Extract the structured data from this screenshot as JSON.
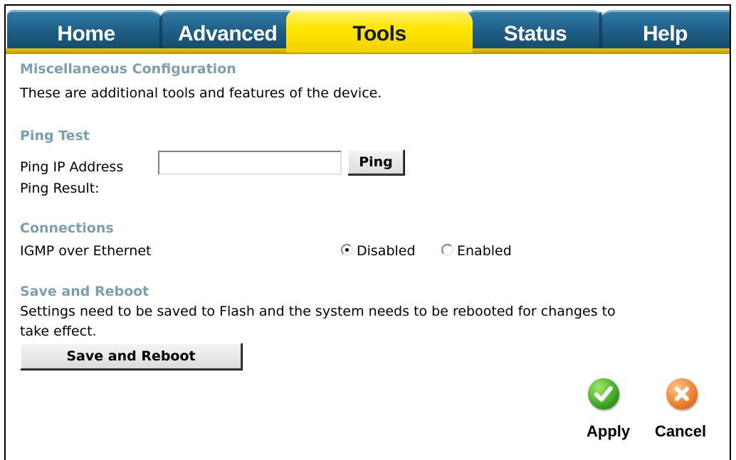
{
  "tabs": [
    {
      "label": "Home"
    },
    {
      "label": "Advanced"
    },
    {
      "label": "Tools"
    },
    {
      "label": "Status"
    },
    {
      "label": "Help"
    }
  ],
  "misc": {
    "title": "Miscellaneous Configuration",
    "description": "These are additional tools and features of the device."
  },
  "ping": {
    "title": "Ping Test",
    "ip_label": "Ping IP Address",
    "ip_value": "",
    "button": "Ping",
    "result_label": "Ping Result:"
  },
  "connections": {
    "title": "Connections",
    "igmp_label": "IGMP over Ethernet",
    "option_disabled": "Disabled",
    "option_enabled": "Enabled",
    "selected": "Disabled"
  },
  "reboot": {
    "title": "Save and Reboot",
    "description_line1": "Settings need to be saved to Flash and the system needs to be rebooted for changes to",
    "description_line2": "take effect.",
    "button": "Save and Reboot"
  },
  "actions": {
    "apply": "Apply",
    "cancel": "Cancel"
  },
  "colors": {
    "tab_blue": "#1f5f88",
    "tab_active": "#ffe600",
    "section_title": "#7a9fb2"
  }
}
